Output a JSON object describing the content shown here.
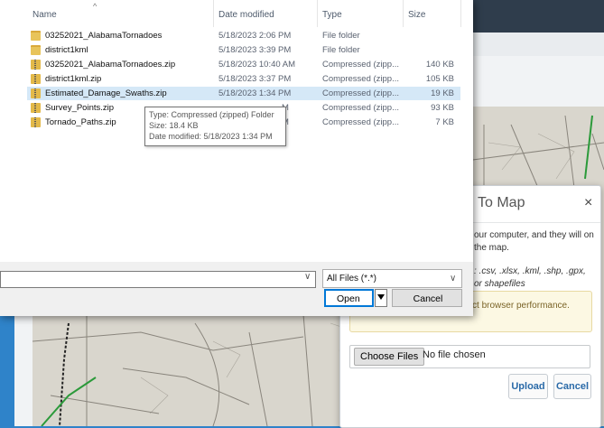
{
  "file_dialog": {
    "columns": {
      "name": "Name",
      "date": "Date modified",
      "type": "Type",
      "size": "Size"
    },
    "files": [
      {
        "name": "03252021_AlabamaTornadoes",
        "date": "5/18/2023 2:06 PM",
        "type": "File folder",
        "size": "",
        "icon": "folder-icon"
      },
      {
        "name": "district1kml",
        "date": "5/18/2023 3:39 PM",
        "type": "File folder",
        "size": "",
        "icon": "folder-icon"
      },
      {
        "name": "03252021_AlabamaTornadoes.zip",
        "date": "5/18/2023 10:40 AM",
        "type": "Compressed (zipp...",
        "size": "140 KB",
        "icon": "zip-icon"
      },
      {
        "name": "district1kml.zip",
        "date": "5/18/2023 3:37 PM",
        "type": "Compressed (zipp...",
        "size": "105 KB",
        "icon": "zip-icon"
      },
      {
        "name": "Estimated_Damage_Swaths.zip",
        "date": "5/18/2023 1:34 PM",
        "type": "Compressed (zipp...",
        "size": "19 KB",
        "icon": "zip-icon"
      },
      {
        "name": "Survey_Points.zip",
        "date": "M",
        "type": "Compressed (zipp...",
        "size": "93 KB",
        "icon": "zip-icon"
      },
      {
        "name": "Tornado_Paths.zip",
        "date": "M",
        "type": "Compressed (zipp...",
        "size": "7 KB",
        "icon": "zip-icon"
      }
    ],
    "tooltip": {
      "type": "Type: Compressed (zipped) Folder",
      "size": "Size: 18.4 KB",
      "modified": "Date modified: 5/18/2023 1:34 PM"
    },
    "filename_value": "",
    "filter_label": "All Files (*.*)",
    "open_label": "Open",
    "cancel_label": "Cancel"
  },
  "upload_modal": {
    "title": "To Map",
    "close": "×",
    "description": "our computer, and they will on the map.",
    "formats": ": .csv, .xlsx, .kml, .shp, .gpx, or shapefiles",
    "warning": "k spatial data may impact browser performance.",
    "choose_label": "Choose Files",
    "no_file": "No file chosen",
    "upload_label": "Upload",
    "cancel_label": "Cancel"
  },
  "colors": {
    "accent": "#2f83c9",
    "selection": "#d5e8f7",
    "link": "#2a6aa8"
  }
}
